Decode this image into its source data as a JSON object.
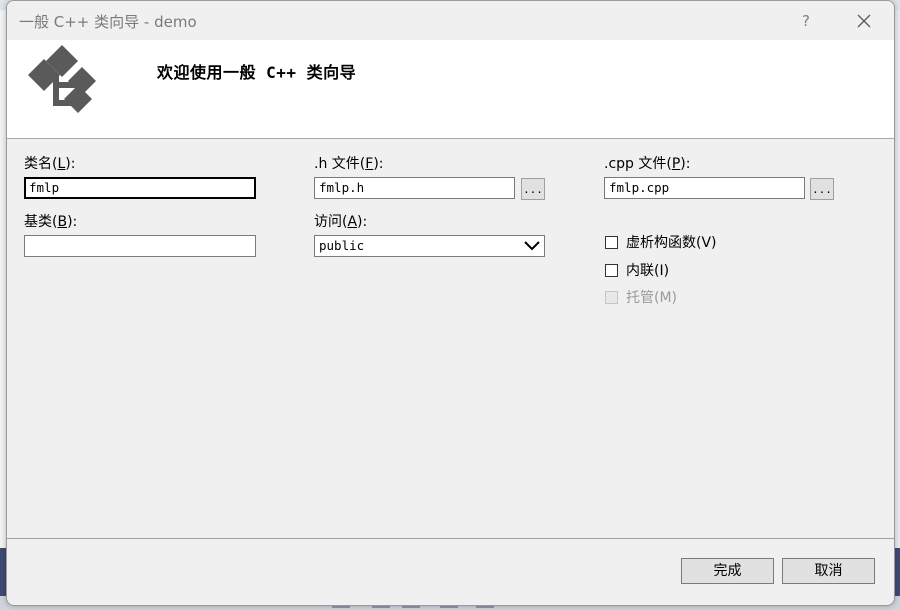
{
  "window": {
    "title": "一般 C++ 类向导 - demo",
    "help": "?",
    "close": "✕"
  },
  "header": {
    "welcome": "欢迎使用一般 C++ 类向导"
  },
  "form": {
    "class_name": {
      "label_pre": "类名(",
      "label_key": "L",
      "label_post": "):",
      "value": "fmlp"
    },
    "base_class": {
      "label_pre": "基类(",
      "label_key": "B",
      "label_post": "):",
      "value": ""
    },
    "h_file": {
      "label_pre": ".h 文件(",
      "label_key": "F",
      "label_post": "):",
      "value": "fmlp.h",
      "browse": "..."
    },
    "access": {
      "label_pre": "访问(",
      "label_key": "A",
      "label_post": "):",
      "value": "public"
    },
    "cpp_file": {
      "label_pre": ".cpp 文件(",
      "label_key": "P",
      "label_post": "):",
      "value": "fmlp.cpp",
      "browse": "..."
    },
    "options": [
      {
        "label": "虚析构函数(V)",
        "checked": false,
        "enabled": true
      },
      {
        "label": "内联(I)",
        "checked": false,
        "enabled": true
      },
      {
        "label": "托管(M)",
        "checked": false,
        "enabled": false
      }
    ]
  },
  "buttons": {
    "finish": "完成",
    "cancel": "取消"
  },
  "colors": {
    "dialog_bg": "#f0f0f0",
    "header_bg": "#ffffff",
    "logo": "#5a5a5a"
  }
}
